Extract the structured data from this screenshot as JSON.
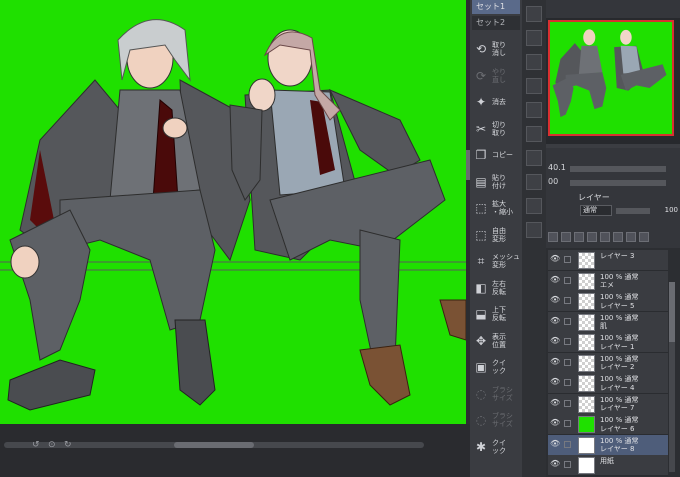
{
  "sets": [
    {
      "label": "セット1"
    },
    {
      "label": "セット2"
    }
  ],
  "tools": [
    {
      "label": "取り\n消し",
      "icon": "undo-icon",
      "glyph": "⟲",
      "enabled": true
    },
    {
      "label": "やり\n直し",
      "icon": "redo-icon",
      "glyph": "⟳",
      "enabled": false
    },
    {
      "label": "消去",
      "icon": "clear-icon",
      "glyph": "✦",
      "enabled": true
    },
    {
      "label": "切り\n取り",
      "icon": "cut-icon",
      "glyph": "✂",
      "enabled": true
    },
    {
      "label": "コピー",
      "icon": "copy-icon",
      "glyph": "❐",
      "enabled": true
    },
    {
      "label": "貼り\n付け",
      "icon": "paste-icon",
      "glyph": "▤",
      "enabled": true
    },
    {
      "label": "拡大\n・縮小",
      "icon": "scale-icon",
      "glyph": "⬚",
      "enabled": true
    },
    {
      "label": "自由\n変形",
      "icon": "free-transform-icon",
      "glyph": "⬚",
      "enabled": true
    },
    {
      "label": "メッシュ\n変形",
      "icon": "mesh-transform-icon",
      "glyph": "⌗",
      "enabled": true
    },
    {
      "label": "左右\n反転",
      "icon": "flip-horizontal-icon",
      "glyph": "◧",
      "enabled": true
    },
    {
      "label": "上下\n反転",
      "icon": "flip-vertical-icon",
      "glyph": "⬓",
      "enabled": true
    },
    {
      "label": "表示\n位置",
      "icon": "view-position-icon",
      "glyph": "✥",
      "enabled": true
    },
    {
      "label": "クイ\nック",
      "icon": "quick-icon",
      "glyph": "▣",
      "enabled": true
    },
    {
      "label": "ブラシ\nサイズ",
      "icon": "brush-size-icon",
      "glyph": "◌",
      "enabled": false
    },
    {
      "label": "ブラシ\nサイズ",
      "icon": "brush-size-2-icon",
      "glyph": "◌",
      "enabled": false
    },
    {
      "label": "クイ\nック",
      "icon": "quick-2-icon",
      "glyph": "✱",
      "enabled": true
    }
  ],
  "properties": {
    "size_value": "40.1",
    "density_value": "00",
    "blend_mode": "通常",
    "opacity": "100",
    "layer_label": "レイヤー"
  },
  "layers": [
    {
      "name": "レイヤー 3",
      "thumb": "checker",
      "selected": false
    },
    {
      "name": "100 % 通常\nエメ",
      "thumb": "checker",
      "selected": false
    },
    {
      "name": "100 % 通常\nレイヤー 5",
      "thumb": "checker",
      "selected": false
    },
    {
      "name": "100 % 通常\n肌",
      "thumb": "checker",
      "selected": false
    },
    {
      "name": "100 % 通常\nレイヤー 1",
      "thumb": "checker",
      "selected": false
    },
    {
      "name": "100 % 通常\nレイヤー 2",
      "thumb": "checker",
      "selected": false
    },
    {
      "name": "100 % 通常\nレイヤー 4",
      "thumb": "checker",
      "selected": false
    },
    {
      "name": "100 % 通常\nレイヤー 7",
      "thumb": "checker",
      "selected": false
    },
    {
      "name": "100 % 通常\nレイヤー 6",
      "thumb": "green",
      "selected": false
    },
    {
      "name": "100 % 通常\nレイヤー 8",
      "thumb": "sil",
      "selected": true
    },
    {
      "name": "用紙",
      "thumb": "white",
      "selected": false
    }
  ],
  "colors": {
    "canvas_bg": "#1fe000",
    "selection": "#4e5d7a",
    "nav_frame": "#d83030"
  }
}
